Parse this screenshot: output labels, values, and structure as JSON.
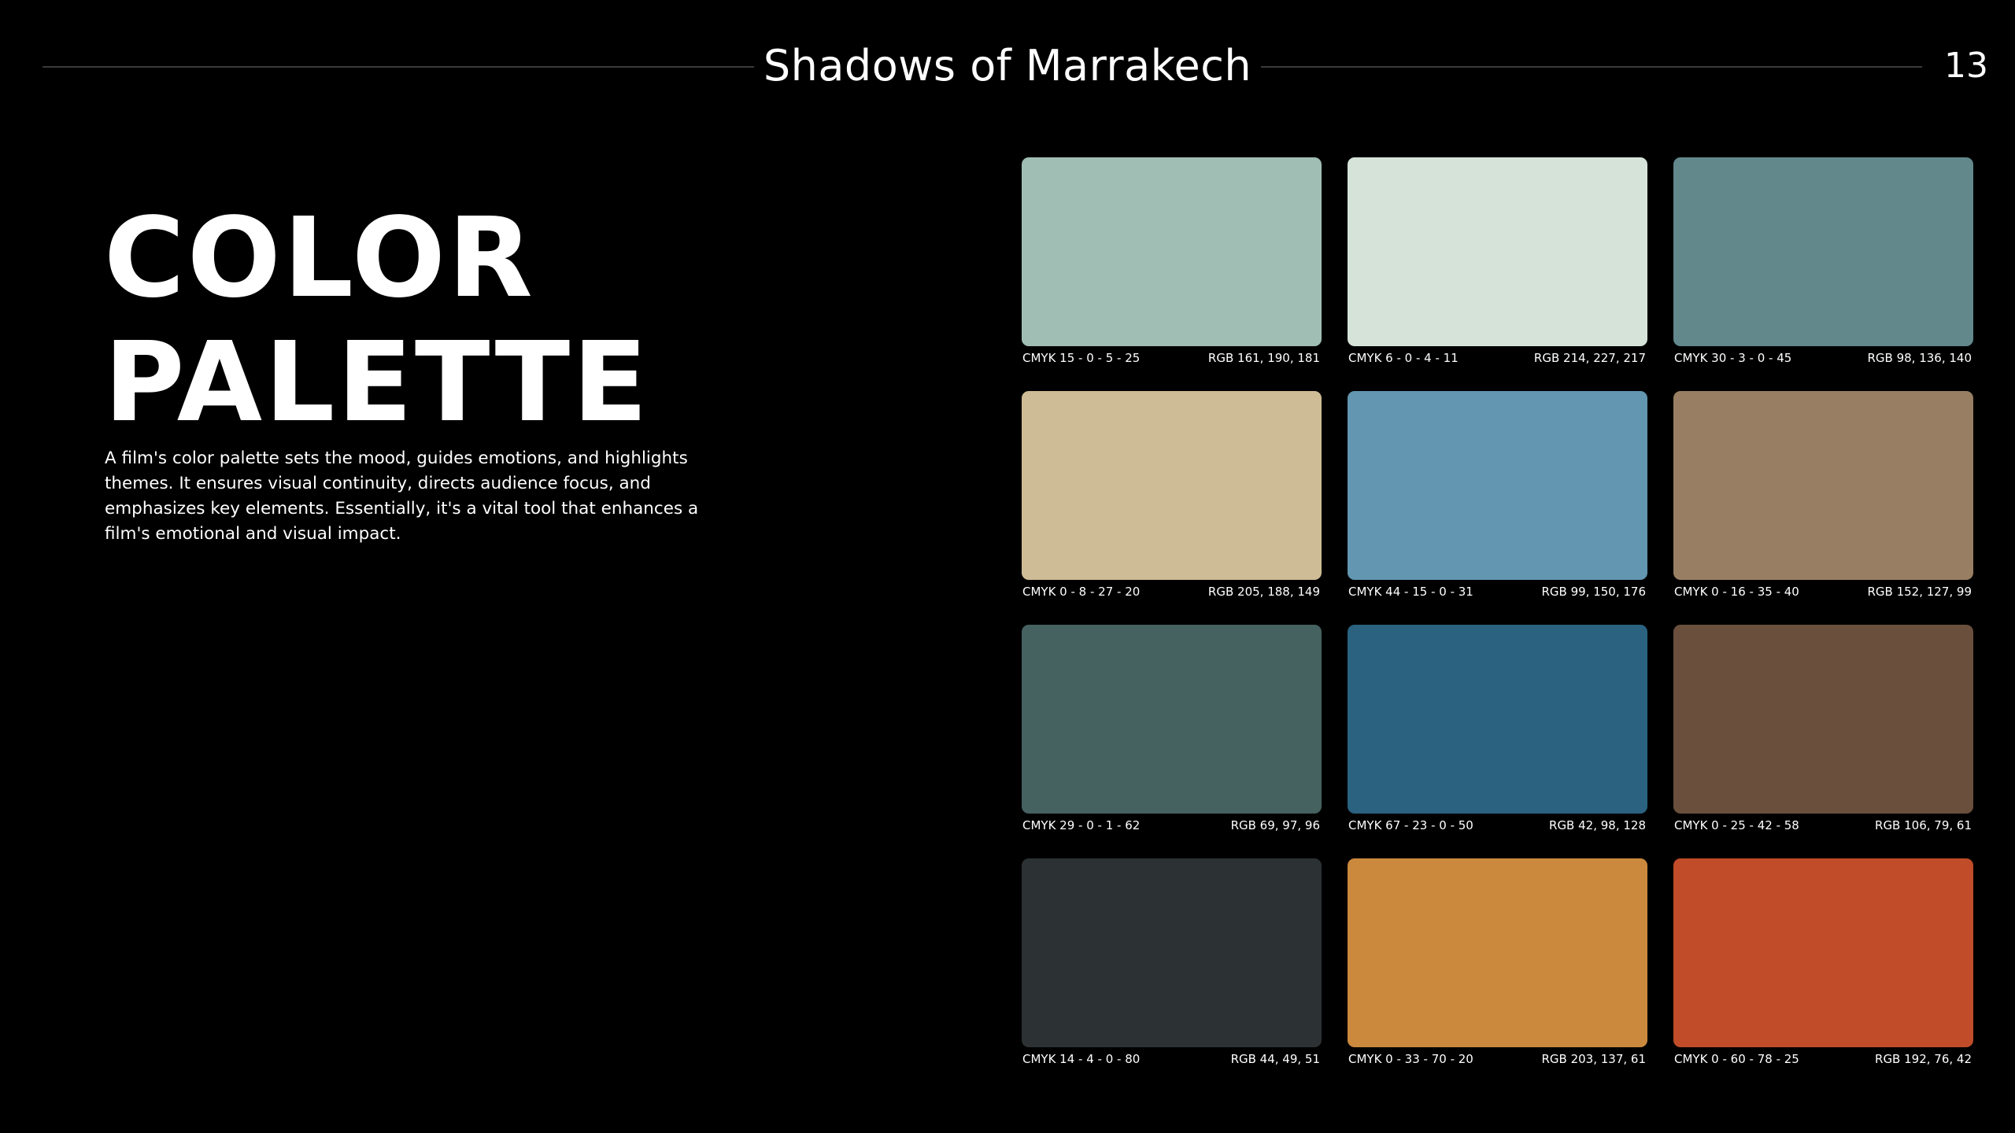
{
  "header": {
    "title": "Shadows of Marrakech",
    "page_number": "13"
  },
  "main": {
    "heading_line1": "COLOR",
    "heading_line2": "PALETTE",
    "description": "A film's color palette sets the mood, guides emotions, and highlights themes. It ensures visual continuity, directs audience focus, and emphasizes key elements. Essentially, it's a vital tool that enhances a film's emotional and visual impact."
  },
  "palette": [
    {
      "hex": "#A1BEB5",
      "cmyk": "CMYK 15 - 0 - 5 - 25",
      "rgb": "RGB 161, 190, 181"
    },
    {
      "hex": "#D6E3D9",
      "cmyk": "CMYK 6 - 0 - 4 - 11",
      "rgb": "RGB 214, 227, 217"
    },
    {
      "hex": "#62888C",
      "cmyk": "CMYK 30 - 3 - 0 - 45",
      "rgb": "RGB 98, 136, 140"
    },
    {
      "hex": "#CDBC95",
      "cmyk": "CMYK 0 - 8 - 27 - 20",
      "rgb": "RGB 205, 188, 149"
    },
    {
      "hex": "#6396B0",
      "cmyk": "CMYK 44 - 15 - 0 - 31",
      "rgb": "RGB 99, 150, 176"
    },
    {
      "hex": "#987F63",
      "cmyk": "CMYK 0 - 16 - 35 - 40",
      "rgb": "RGB 152, 127, 99"
    },
    {
      "hex": "#456160",
      "cmyk": "CMYK 29 - 0 - 1 - 62",
      "rgb": "RGB 69, 97, 96"
    },
    {
      "hex": "#2A6280",
      "cmyk": "CMYK 67 - 23 - 0 - 50",
      "rgb": "RGB 42, 98, 128"
    },
    {
      "hex": "#6A4F3D",
      "cmyk": "CMYK 0 - 25 - 42 - 58",
      "rgb": "RGB 106, 79, 61"
    },
    {
      "hex": "#2C3133",
      "cmyk": "CMYK 14 - 4 - 0 - 80",
      "rgb": "RGB 44, 49, 51"
    },
    {
      "hex": "#CB893D",
      "cmyk": "CMYK 0 - 33 - 70 - 20",
      "rgb": "RGB 203, 137, 61"
    },
    {
      "hex": "#C04C2A",
      "cmyk": "CMYK 0 - 60 - 78 - 25",
      "rgb": "RGB 192, 76, 42"
    }
  ]
}
